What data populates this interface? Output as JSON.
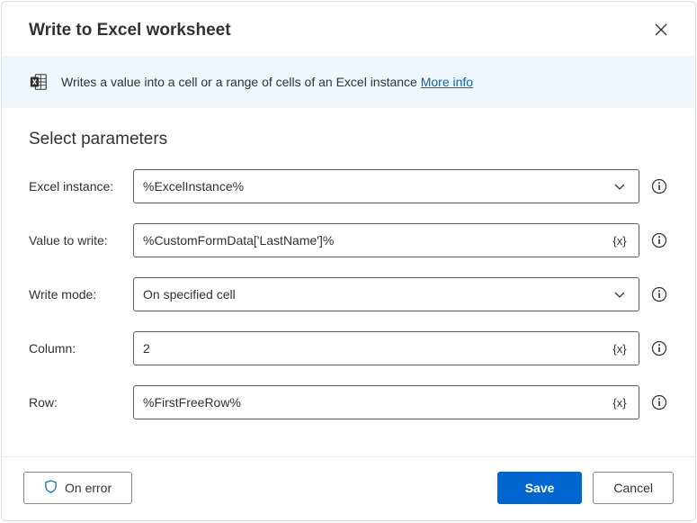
{
  "header": {
    "title": "Write to Excel worksheet"
  },
  "banner": {
    "description": "Writes a value into a cell or a range of cells of an Excel instance",
    "more_info": "More info"
  },
  "section_title": "Select parameters",
  "fields": {
    "excel_instance": {
      "label": "Excel instance:",
      "value": "%ExcelInstance%"
    },
    "value_to_write": {
      "label": "Value to write:",
      "value": "%CustomFormData['LastName']%"
    },
    "write_mode": {
      "label": "Write mode:",
      "value": "On specified cell"
    },
    "column": {
      "label": "Column:",
      "value": "2"
    },
    "row": {
      "label": "Row:",
      "value": "%FirstFreeRow%"
    }
  },
  "footer": {
    "on_error": "On error",
    "save": "Save",
    "cancel": "Cancel"
  },
  "glyphs": {
    "variable": "{x}"
  }
}
